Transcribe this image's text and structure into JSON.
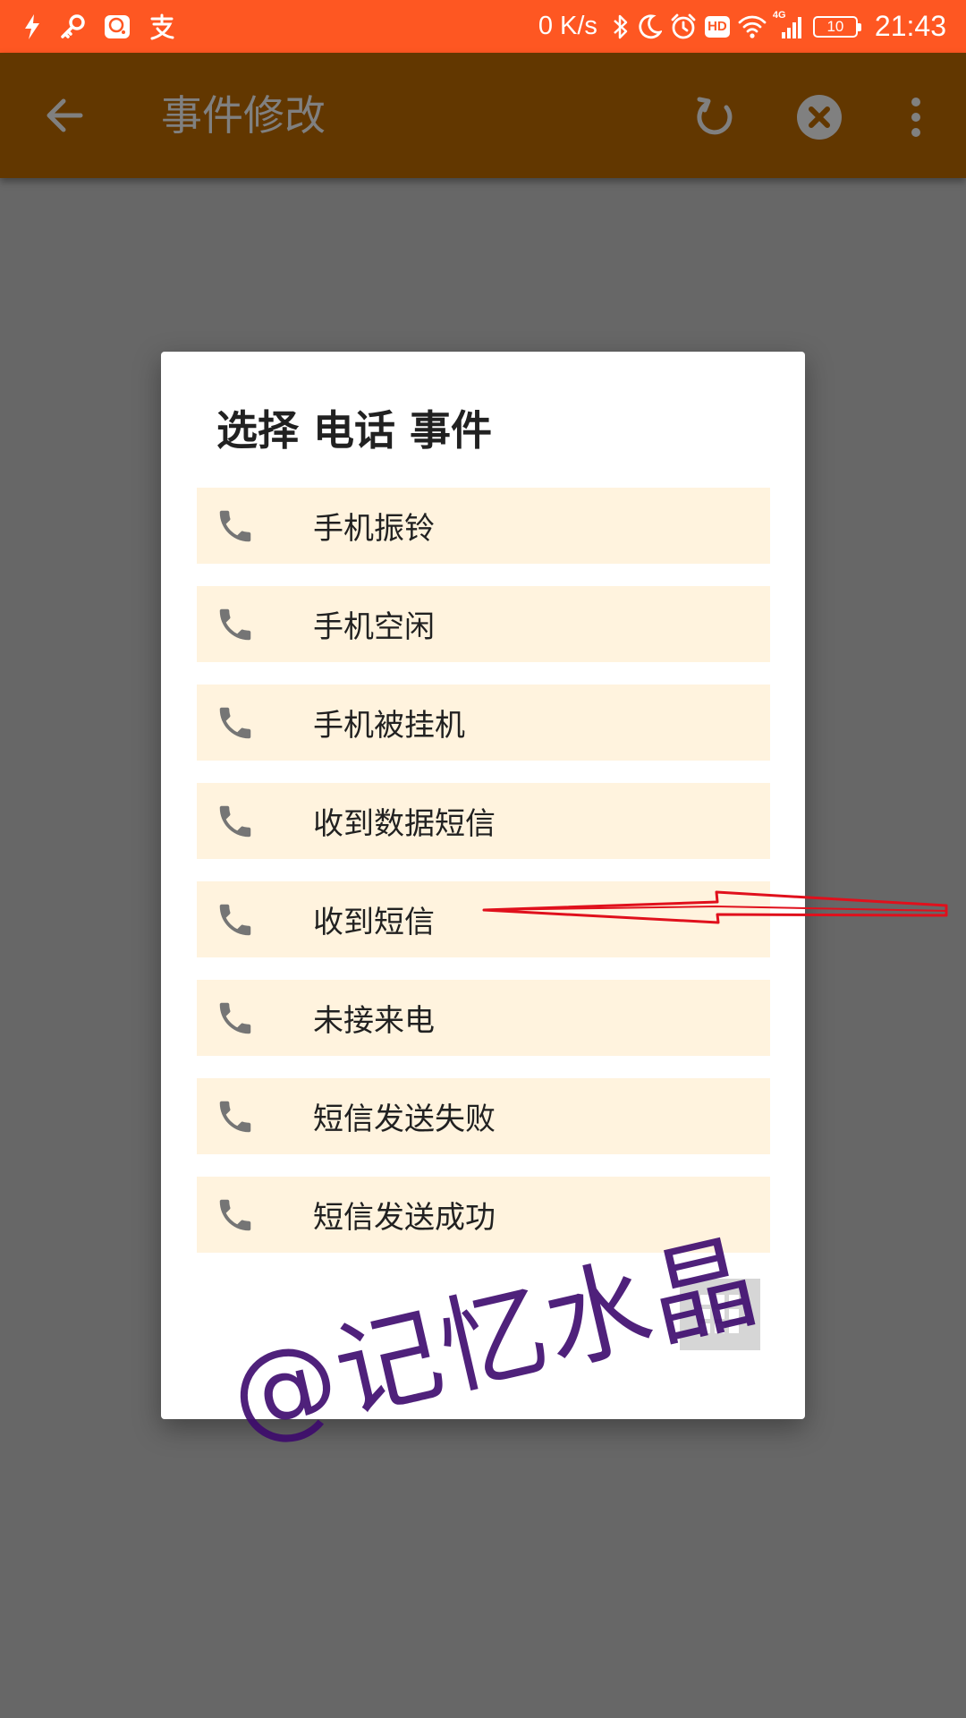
{
  "status_bar": {
    "network_speed": "0 K/s",
    "hd_badge": "HD",
    "signal_label": "4G",
    "battery": "10",
    "time": "21:43",
    "icons": [
      "flash-icon",
      "key-icon",
      "chat-icon",
      "alipay-icon",
      "bluetooth-icon",
      "moon-icon",
      "alarm-icon",
      "wifi-icon",
      "signal-icon",
      "battery-icon"
    ]
  },
  "app_bar": {
    "title": "事件修改",
    "icons": [
      "back-arrow-icon",
      "refresh-icon",
      "close-circle-icon",
      "more-vert-icon"
    ]
  },
  "dialog": {
    "title": "选择 电话 事件",
    "items": [
      {
        "label": "手机振铃",
        "icon": "phone-icon"
      },
      {
        "label": "手机空闲",
        "icon": "phone-icon"
      },
      {
        "label": "手机被挂机",
        "icon": "phone-icon"
      },
      {
        "label": "收到数据短信",
        "icon": "phone-icon"
      },
      {
        "label": "收到短信",
        "icon": "phone-icon"
      },
      {
        "label": "未接来电",
        "icon": "phone-icon"
      },
      {
        "label": "短信发送失败",
        "icon": "phone-icon"
      },
      {
        "label": "短信发送成功",
        "icon": "phone-icon"
      }
    ],
    "keypad_icon": "dialpad-icon"
  },
  "overlay": {
    "watermark": "@记忆水晶"
  },
  "colors": {
    "status_bar": "#fe5722",
    "app_bar_dimmed": "#623700",
    "scrim": "#676767",
    "dialog_bg": "#ffffff",
    "item_bg": "#fff3de",
    "icon_gray": "#757575",
    "annotation_arrow": "#e0101c",
    "watermark": "#3d0a6d"
  }
}
